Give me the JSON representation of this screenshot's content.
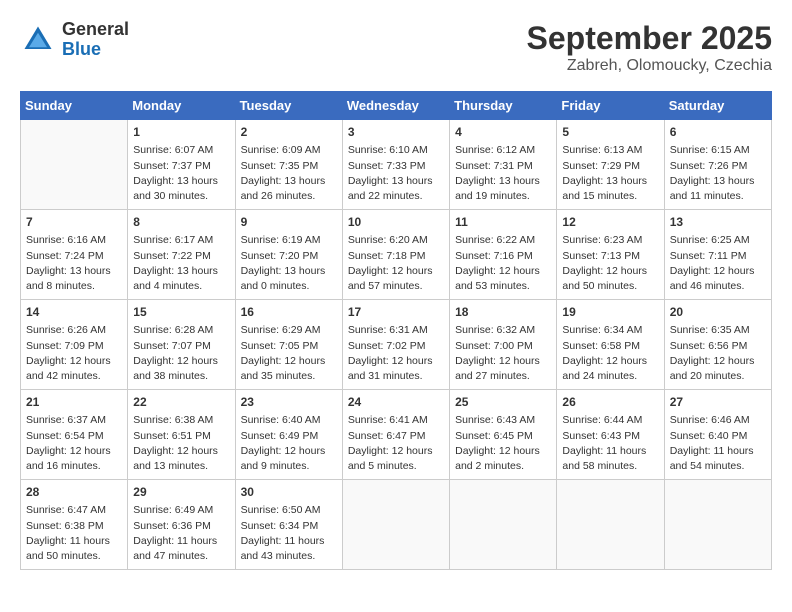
{
  "header": {
    "logo_line1": "General",
    "logo_line2": "Blue",
    "title": "September 2025",
    "subtitle": "Zabreh, Olomoucky, Czechia"
  },
  "days_of_week": [
    "Sunday",
    "Monday",
    "Tuesday",
    "Wednesday",
    "Thursday",
    "Friday",
    "Saturday"
  ],
  "weeks": [
    [
      {
        "day": "",
        "content": ""
      },
      {
        "day": "1",
        "content": "Sunrise: 6:07 AM\nSunset: 7:37 PM\nDaylight: 13 hours\nand 30 minutes."
      },
      {
        "day": "2",
        "content": "Sunrise: 6:09 AM\nSunset: 7:35 PM\nDaylight: 13 hours\nand 26 minutes."
      },
      {
        "day": "3",
        "content": "Sunrise: 6:10 AM\nSunset: 7:33 PM\nDaylight: 13 hours\nand 22 minutes."
      },
      {
        "day": "4",
        "content": "Sunrise: 6:12 AM\nSunset: 7:31 PM\nDaylight: 13 hours\nand 19 minutes."
      },
      {
        "day": "5",
        "content": "Sunrise: 6:13 AM\nSunset: 7:29 PM\nDaylight: 13 hours\nand 15 minutes."
      },
      {
        "day": "6",
        "content": "Sunrise: 6:15 AM\nSunset: 7:26 PM\nDaylight: 13 hours\nand 11 minutes."
      }
    ],
    [
      {
        "day": "7",
        "content": "Sunrise: 6:16 AM\nSunset: 7:24 PM\nDaylight: 13 hours\nand 8 minutes."
      },
      {
        "day": "8",
        "content": "Sunrise: 6:17 AM\nSunset: 7:22 PM\nDaylight: 13 hours\nand 4 minutes."
      },
      {
        "day": "9",
        "content": "Sunrise: 6:19 AM\nSunset: 7:20 PM\nDaylight: 13 hours\nand 0 minutes."
      },
      {
        "day": "10",
        "content": "Sunrise: 6:20 AM\nSunset: 7:18 PM\nDaylight: 12 hours\nand 57 minutes."
      },
      {
        "day": "11",
        "content": "Sunrise: 6:22 AM\nSunset: 7:16 PM\nDaylight: 12 hours\nand 53 minutes."
      },
      {
        "day": "12",
        "content": "Sunrise: 6:23 AM\nSunset: 7:13 PM\nDaylight: 12 hours\nand 50 minutes."
      },
      {
        "day": "13",
        "content": "Sunrise: 6:25 AM\nSunset: 7:11 PM\nDaylight: 12 hours\nand 46 minutes."
      }
    ],
    [
      {
        "day": "14",
        "content": "Sunrise: 6:26 AM\nSunset: 7:09 PM\nDaylight: 12 hours\nand 42 minutes."
      },
      {
        "day": "15",
        "content": "Sunrise: 6:28 AM\nSunset: 7:07 PM\nDaylight: 12 hours\nand 38 minutes."
      },
      {
        "day": "16",
        "content": "Sunrise: 6:29 AM\nSunset: 7:05 PM\nDaylight: 12 hours\nand 35 minutes."
      },
      {
        "day": "17",
        "content": "Sunrise: 6:31 AM\nSunset: 7:02 PM\nDaylight: 12 hours\nand 31 minutes."
      },
      {
        "day": "18",
        "content": "Sunrise: 6:32 AM\nSunset: 7:00 PM\nDaylight: 12 hours\nand 27 minutes."
      },
      {
        "day": "19",
        "content": "Sunrise: 6:34 AM\nSunset: 6:58 PM\nDaylight: 12 hours\nand 24 minutes."
      },
      {
        "day": "20",
        "content": "Sunrise: 6:35 AM\nSunset: 6:56 PM\nDaylight: 12 hours\nand 20 minutes."
      }
    ],
    [
      {
        "day": "21",
        "content": "Sunrise: 6:37 AM\nSunset: 6:54 PM\nDaylight: 12 hours\nand 16 minutes."
      },
      {
        "day": "22",
        "content": "Sunrise: 6:38 AM\nSunset: 6:51 PM\nDaylight: 12 hours\nand 13 minutes."
      },
      {
        "day": "23",
        "content": "Sunrise: 6:40 AM\nSunset: 6:49 PM\nDaylight: 12 hours\nand 9 minutes."
      },
      {
        "day": "24",
        "content": "Sunrise: 6:41 AM\nSunset: 6:47 PM\nDaylight: 12 hours\nand 5 minutes."
      },
      {
        "day": "25",
        "content": "Sunrise: 6:43 AM\nSunset: 6:45 PM\nDaylight: 12 hours\nand 2 minutes."
      },
      {
        "day": "26",
        "content": "Sunrise: 6:44 AM\nSunset: 6:43 PM\nDaylight: 11 hours\nand 58 minutes."
      },
      {
        "day": "27",
        "content": "Sunrise: 6:46 AM\nSunset: 6:40 PM\nDaylight: 11 hours\nand 54 minutes."
      }
    ],
    [
      {
        "day": "28",
        "content": "Sunrise: 6:47 AM\nSunset: 6:38 PM\nDaylight: 11 hours\nand 50 minutes."
      },
      {
        "day": "29",
        "content": "Sunrise: 6:49 AM\nSunset: 6:36 PM\nDaylight: 11 hours\nand 47 minutes."
      },
      {
        "day": "30",
        "content": "Sunrise: 6:50 AM\nSunset: 6:34 PM\nDaylight: 11 hours\nand 43 minutes."
      },
      {
        "day": "",
        "content": ""
      },
      {
        "day": "",
        "content": ""
      },
      {
        "day": "",
        "content": ""
      },
      {
        "day": "",
        "content": ""
      }
    ]
  ]
}
